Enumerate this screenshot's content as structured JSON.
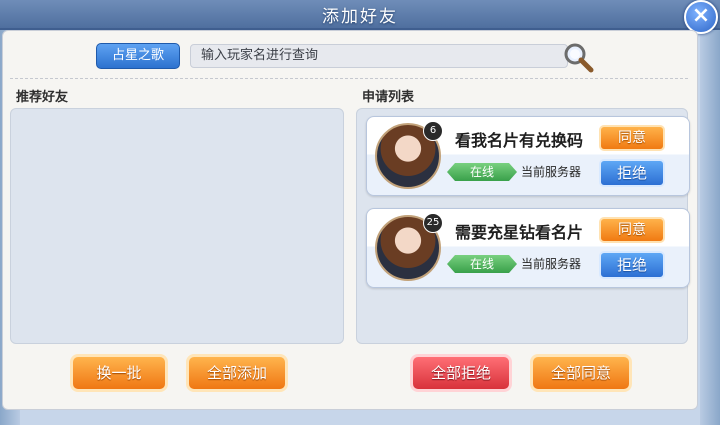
{
  "window": {
    "title": "添加好友"
  },
  "search": {
    "server_button": "占星之歌",
    "placeholder": "输入玩家名进行查询"
  },
  "sections": {
    "recommended": "推荐好友",
    "requests": "申请列表"
  },
  "requests": [
    {
      "level": "6",
      "name": "看我名片有兑换码",
      "status": "在线",
      "server": "当前服务器",
      "accept": "同意",
      "reject": "拒绝"
    },
    {
      "level": "25",
      "name": "需要充星钻看名片",
      "status": "在线",
      "server": "当前服务器",
      "accept": "同意",
      "reject": "拒绝"
    }
  ],
  "actions": {
    "refresh": "换一批",
    "add_all": "全部添加",
    "reject_all": "全部拒绝",
    "accept_all": "全部同意"
  },
  "colors": {
    "accent_blue": "#2c6fd3",
    "accent_orange": "#f07a12",
    "online_green": "#39a04a",
    "reject_red": "#d8323b"
  }
}
